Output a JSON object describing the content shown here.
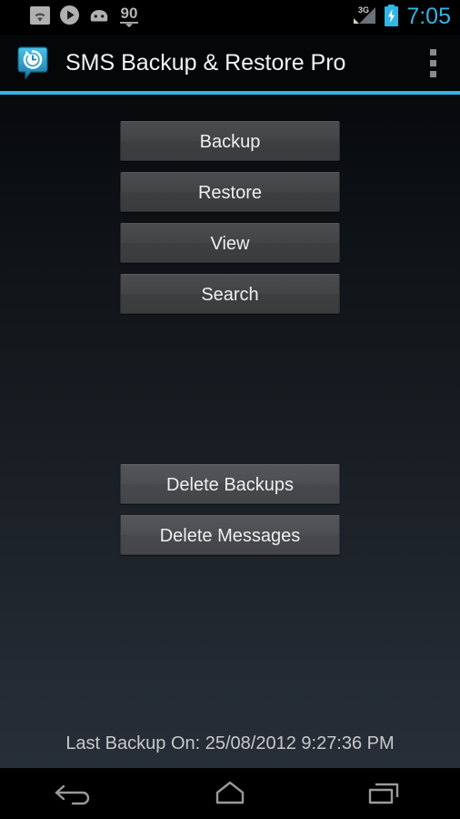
{
  "status_bar": {
    "icons": [
      {
        "name": "wifi-icon",
        "label": "WiFi"
      },
      {
        "name": "play-icon",
        "label": "Play"
      },
      {
        "name": "android-head-icon",
        "label": "Android"
      },
      {
        "name": "download-count-icon",
        "label": "90"
      }
    ],
    "download_count": "90",
    "network_type": "3G",
    "battery": {
      "name": "battery-charging-icon",
      "label": "Charging"
    },
    "time": "7:05",
    "time_color": "#33b5e5"
  },
  "action_bar": {
    "app_icon_name": "sms-backup-restore-app-icon",
    "title": "SMS Backup & Restore Pro",
    "overflow_label": "More options",
    "accent_color": "#33b5e5"
  },
  "main": {
    "primary_buttons": [
      {
        "label": "Backup",
        "name": "backup-button"
      },
      {
        "label": "Restore",
        "name": "restore-button"
      },
      {
        "label": "View",
        "name": "view-button"
      },
      {
        "label": "Search",
        "name": "search-button"
      }
    ],
    "danger_buttons": [
      {
        "label": "Delete Backups",
        "name": "delete-backups-button"
      },
      {
        "label": "Delete Messages",
        "name": "delete-messages-button"
      }
    ],
    "last_backup_text": "Last Backup On: 25/08/2012 9:27:36 PM"
  },
  "nav_bar": {
    "back_label": "Back",
    "home_label": "Home",
    "recents_label": "Recent apps"
  }
}
